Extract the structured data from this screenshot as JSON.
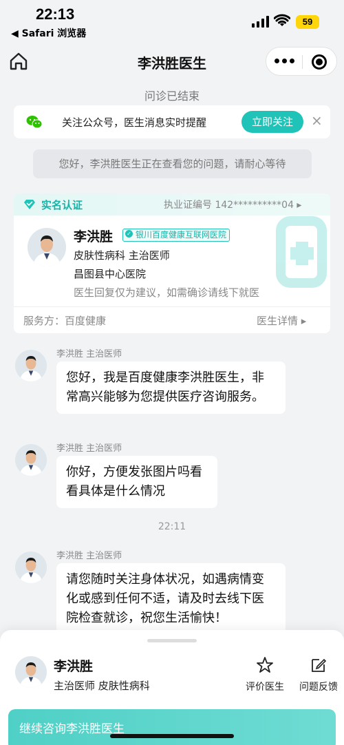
{
  "status": {
    "time": "22:13",
    "back_app": "◀ Safari 浏览器",
    "battery": "59"
  },
  "nav": {
    "title": "李洪胜医生"
  },
  "consult_status": "问诊已结束",
  "follow_banner": {
    "text": "关注公众号，医生消息实时提醒",
    "button": "立即关注",
    "close": "×"
  },
  "system_message": "您好，李洪胜医生正在查看您的问题，请耐心等待",
  "doctor_card": {
    "verify_label": "实名认证",
    "license": "执业证编号 142**********04 ▸",
    "name": "李洪胜",
    "badge": "银川百度健康互联网医院",
    "dept": "皮肤性病科  主治医师",
    "hospital": "昌图县中心医院",
    "note": "医生回复仅为建议，如需确诊请线下就医",
    "service": "服务方：百度健康",
    "detail": "医生详情 ▸"
  },
  "messages": [
    {
      "sender": "李洪胜 主治医师",
      "text": "您好，我是百度健康李洪胜医生，非常高兴能够为您提供医疗咨询服务。"
    },
    {
      "sender": "李洪胜 主治医师",
      "text": "你好，方便发张图片吗看看具体是什么情况"
    },
    {
      "sender": "李洪胜 主治医师",
      "text": "请您随时关注身体状况，如遇病情变化或感到任何不适，请及时去线下医院检查就诊，祝您生活愉快！"
    }
  ],
  "timestamp": "22:11",
  "bottom_sheet": {
    "name": "李洪胜",
    "sub": "主治医师  皮肤性病科",
    "rate": "评价医生",
    "feedback": "问题反馈",
    "continue": "继续咨询李洪胜医生"
  },
  "colors": {
    "accent": "#1fc3b8",
    "background": "#f2f3f5"
  }
}
